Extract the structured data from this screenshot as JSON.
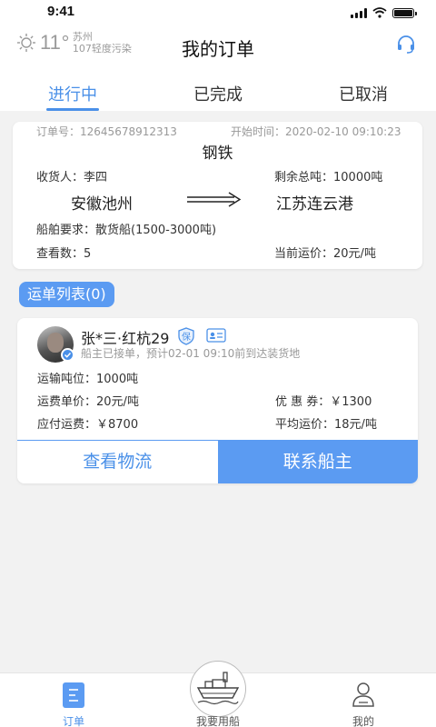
{
  "status_bar": {
    "time": "9:41"
  },
  "header": {
    "temperature": "11",
    "city": "苏州",
    "air_quality": "107轻度污染",
    "title": "我的订单"
  },
  "tabs": [
    {
      "label": "进行中",
      "active": true
    },
    {
      "label": "已完成",
      "active": false
    },
    {
      "label": "已取消",
      "active": false
    }
  ],
  "order": {
    "order_no_label": "订单号：",
    "order_no": "12645678912313",
    "start_time_label": "开始时间：",
    "start_time": "2020-02-10 09:10:23",
    "cargo": "钢铁",
    "consignee_label": "收货人：",
    "consignee": "李四",
    "remaining_label": "剩余总吨：",
    "remaining": "10000吨",
    "origin": "安徽池州",
    "destination": "江苏连云港",
    "ship_req_label": "船舶要求：",
    "ship_req": "散货船(1500-3000吨)",
    "views_label": "查看数：",
    "views": "5",
    "freight_label": "当前运价：",
    "freight": "20元/吨"
  },
  "section": {
    "waybill_list": "运单列表(0)"
  },
  "waybill": {
    "name": "张*三·红杭29",
    "badge_text": "保",
    "status": "船主已接单，预计02-01 09:10前到达装货地",
    "tonnage_label": "运输吨位：",
    "tonnage": "1000吨",
    "unit_price_label": "运费单价：",
    "unit_price": "20元/吨",
    "coupon_label": "优 惠 券：",
    "coupon": "￥1300",
    "payable_label": "应付运费：",
    "payable": "￥8700",
    "avg_label": "平均运价：",
    "avg": "18元/吨",
    "btn_logistics": "查看物流",
    "btn_contact": "联系船主"
  },
  "bottom_nav": [
    {
      "label": "订单",
      "icon": "order-icon",
      "active": true
    },
    {
      "label": "我要用船",
      "icon": "ship-icon",
      "active": false
    },
    {
      "label": "我的",
      "icon": "user-icon",
      "active": false
    }
  ],
  "colors": {
    "accent": "#4a90e8",
    "accent_fill": "#5b9bf2",
    "background": "#f2f2f2"
  }
}
